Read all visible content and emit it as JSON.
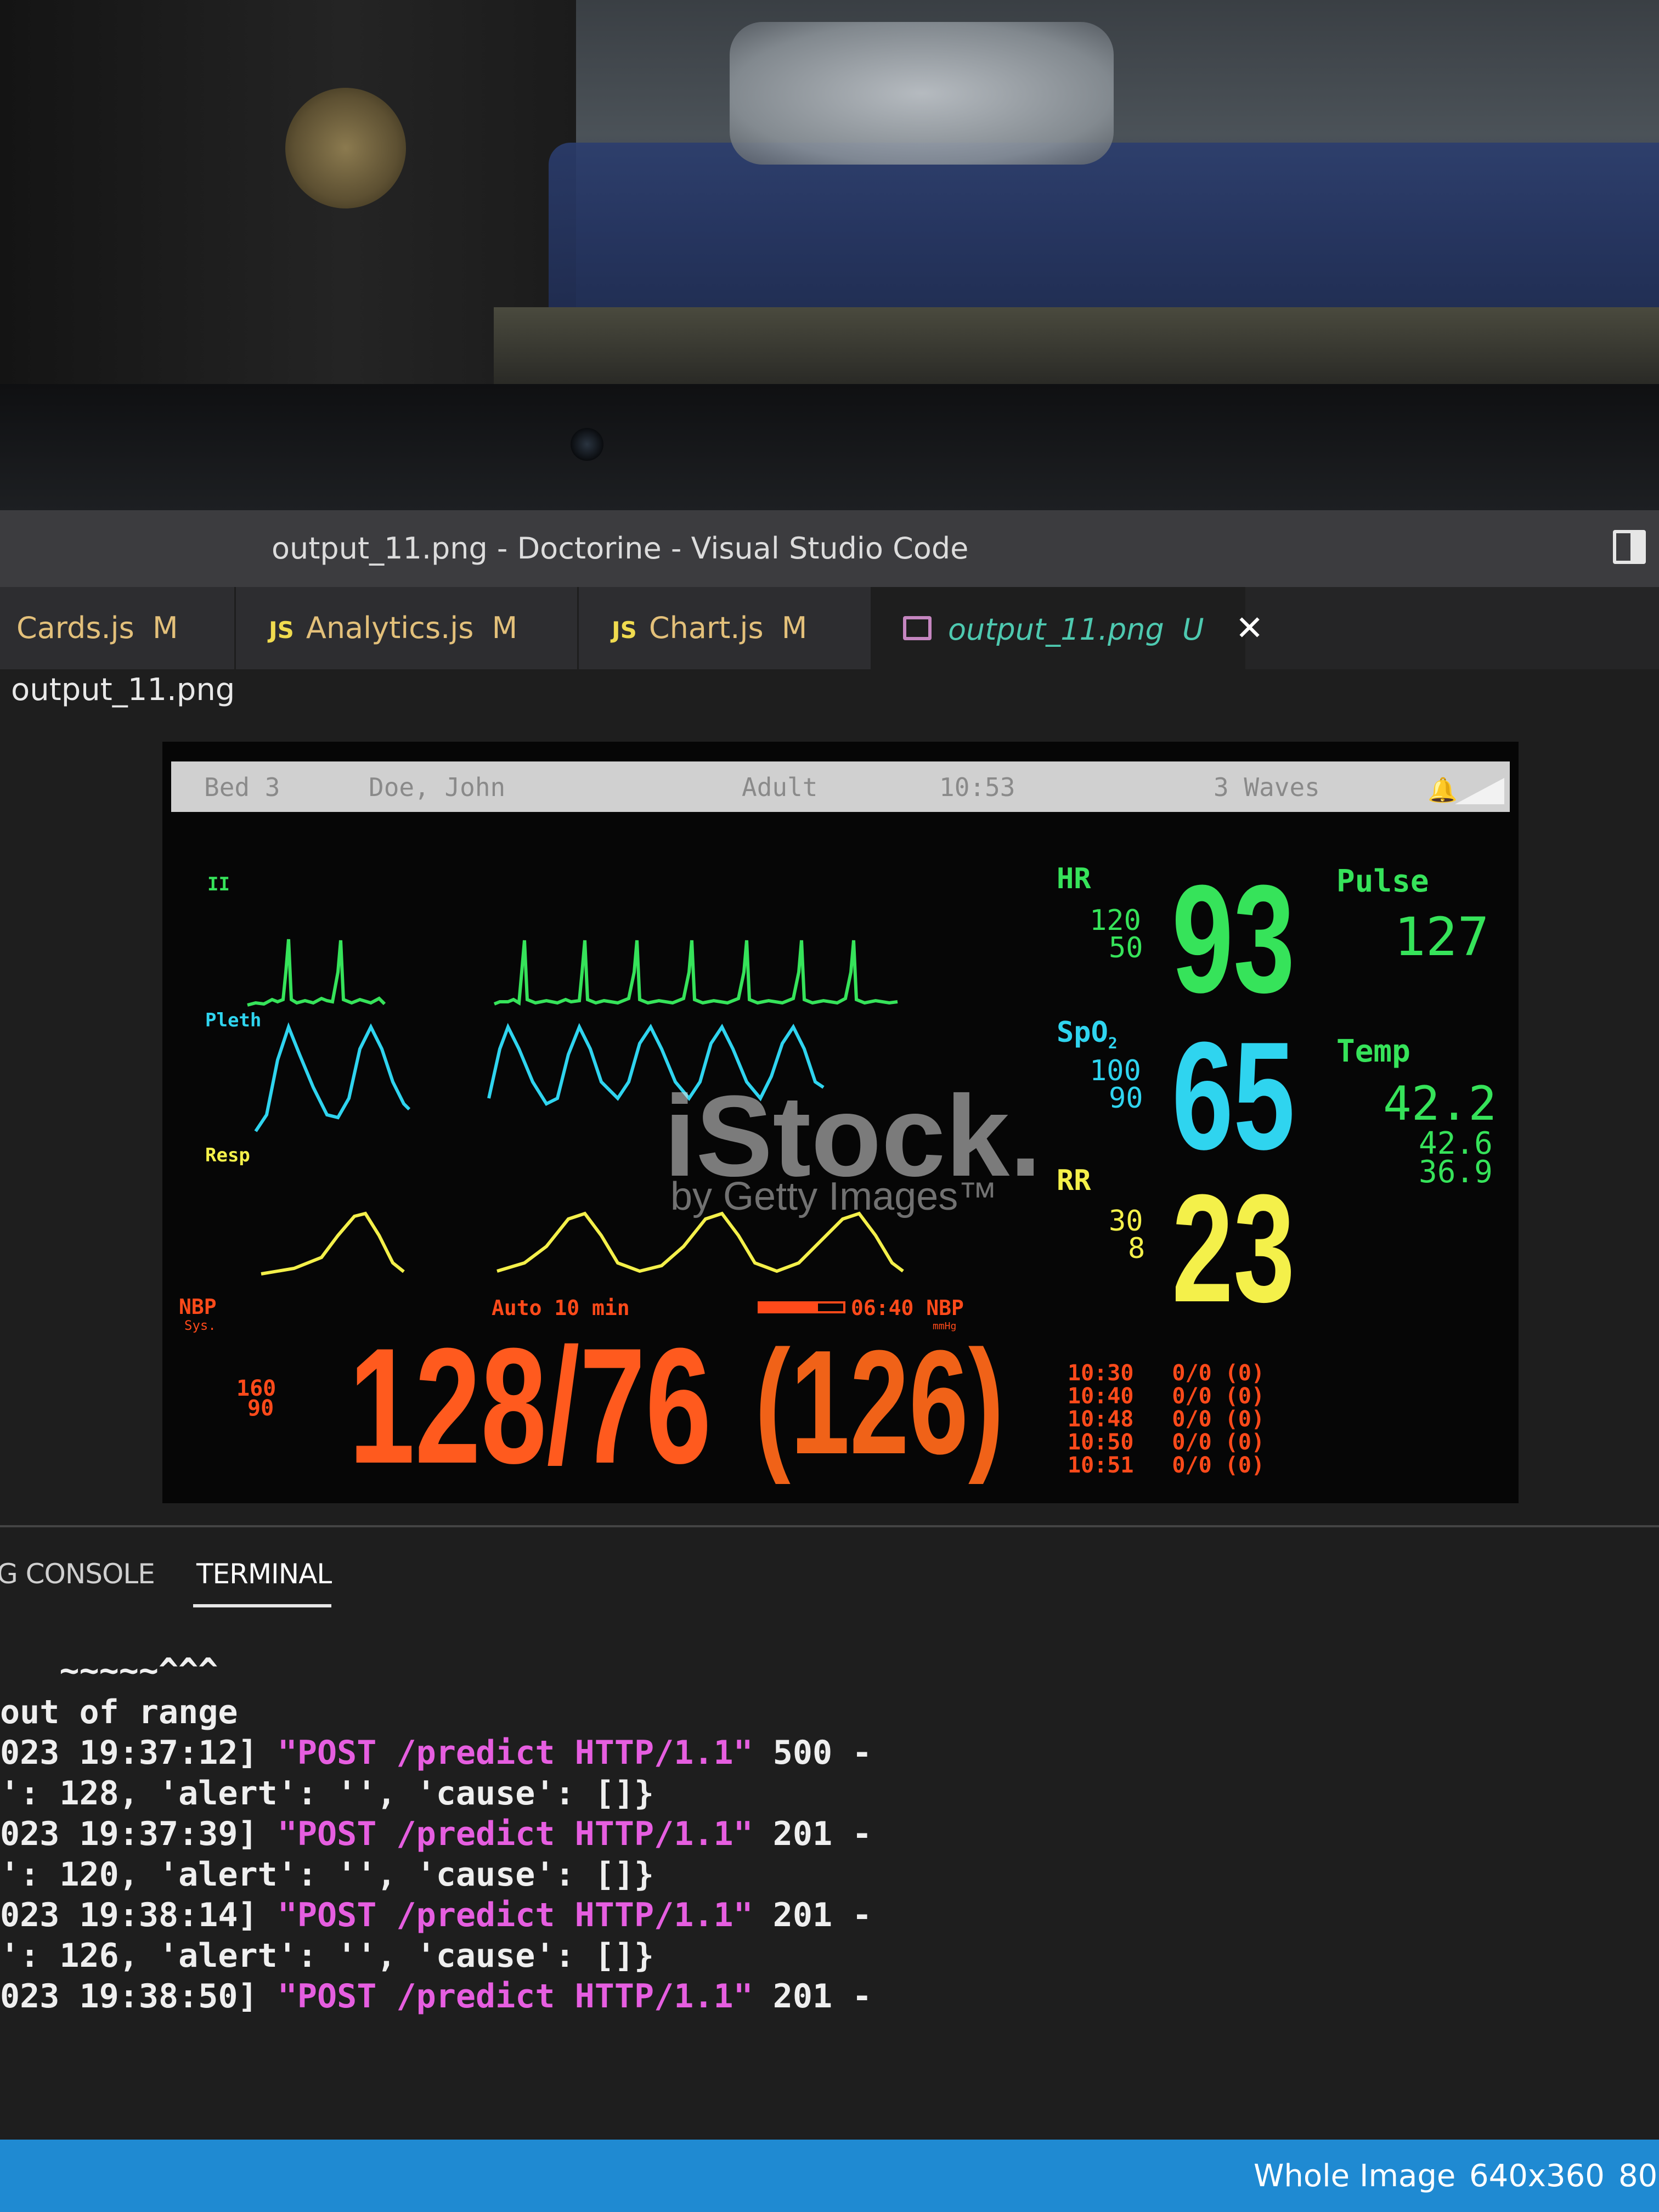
{
  "window": {
    "title": "output_11.png - Doctorine - Visual Studio Code"
  },
  "tabs": [
    {
      "name": "Cards.js",
      "status": "M"
    },
    {
      "name": "Analytics.js",
      "status": "M",
      "icon": "JS"
    },
    {
      "name": "Chart.js",
      "status": "M",
      "icon": "JS"
    },
    {
      "name": "output_11.png",
      "status": "U",
      "close": "✕"
    }
  ],
  "breadcrumb": "output_11.png",
  "monitor": {
    "header": {
      "bed": "Bed 3",
      "patient": "Doe, John",
      "mode": "Adult",
      "time": "10:53",
      "waves": "3 Waves"
    },
    "waves": {
      "ecg": "II",
      "pleth": "Pleth",
      "resp": "Resp"
    },
    "hr": {
      "label": "HR",
      "high": "120",
      "low": "50",
      "value": "93",
      "color": "#36e35a"
    },
    "pulse": {
      "label": "Pulse",
      "value": "127"
    },
    "spo2": {
      "label": "SpO",
      "sub": "2",
      "high": "100",
      "low": "90",
      "value": "65",
      "color": "#2fd4ef"
    },
    "temp": {
      "label": "Temp",
      "value": "42.2",
      "v2": "42.6",
      "v3": "36.9"
    },
    "rr": {
      "label": "RR",
      "high": "30",
      "low": "8",
      "value": "23",
      "color": "#f4f04a"
    },
    "nbp": {
      "label": "NBP",
      "sys": "Sys.",
      "high": "160",
      "low": "90",
      "auto": "Auto 10 min",
      "timer": "06:40 NBP",
      "unit": "mmHg",
      "value": "128/76",
      "mean": "(126)",
      "color": "#ff4a1a",
      "history": [
        {
          "time": "10:30",
          "val": "0/0 (0)"
        },
        {
          "time": "10:40",
          "val": "0/0 (0)"
        },
        {
          "time": "10:48",
          "val": "0/0 (0)"
        },
        {
          "time": "10:50",
          "val": "0/0 (0)"
        },
        {
          "time": "10:51",
          "val": "0/0 (0)"
        }
      ]
    },
    "watermark": {
      "brand": "iStock.",
      "by": "by Getty Images™"
    }
  },
  "panel": {
    "tabs": [
      "G CONSOLE",
      "TERMINAL"
    ],
    "lines": [
      {
        "pre": "   ~~~~~^^^",
        "pink": "",
        "post": ""
      },
      {
        "pre": "out of range",
        "pink": "",
        "post": ""
      },
      {
        "pre": "023 19:37:12] ",
        "pink": "\"POST /predict HTTP/1.1\"",
        "post": " 500 -"
      },
      {
        "pre": "': 128, 'alert': '', 'cause': []}",
        "pink": "",
        "post": ""
      },
      {
        "pre": "023 19:37:39] ",
        "pink": "\"POST /predict HTTP/1.1\"",
        "post": " 201 -"
      },
      {
        "pre": "': 120, 'alert': '', 'cause': []}",
        "pink": "",
        "post": ""
      },
      {
        "pre": "023 19:38:14] ",
        "pink": "\"POST /predict HTTP/1.1\"",
        "post": " 201 -"
      },
      {
        "pre": "': 126, 'alert': '', 'cause': []}",
        "pink": "",
        "post": ""
      },
      {
        "pre": "023 19:38:50] ",
        "pink": "\"POST /predict HTTP/1.1\"",
        "post": " 201 -"
      }
    ]
  },
  "statusbar": {
    "view": "Whole Image",
    "size": "640x360",
    "zoom": "80."
  }
}
